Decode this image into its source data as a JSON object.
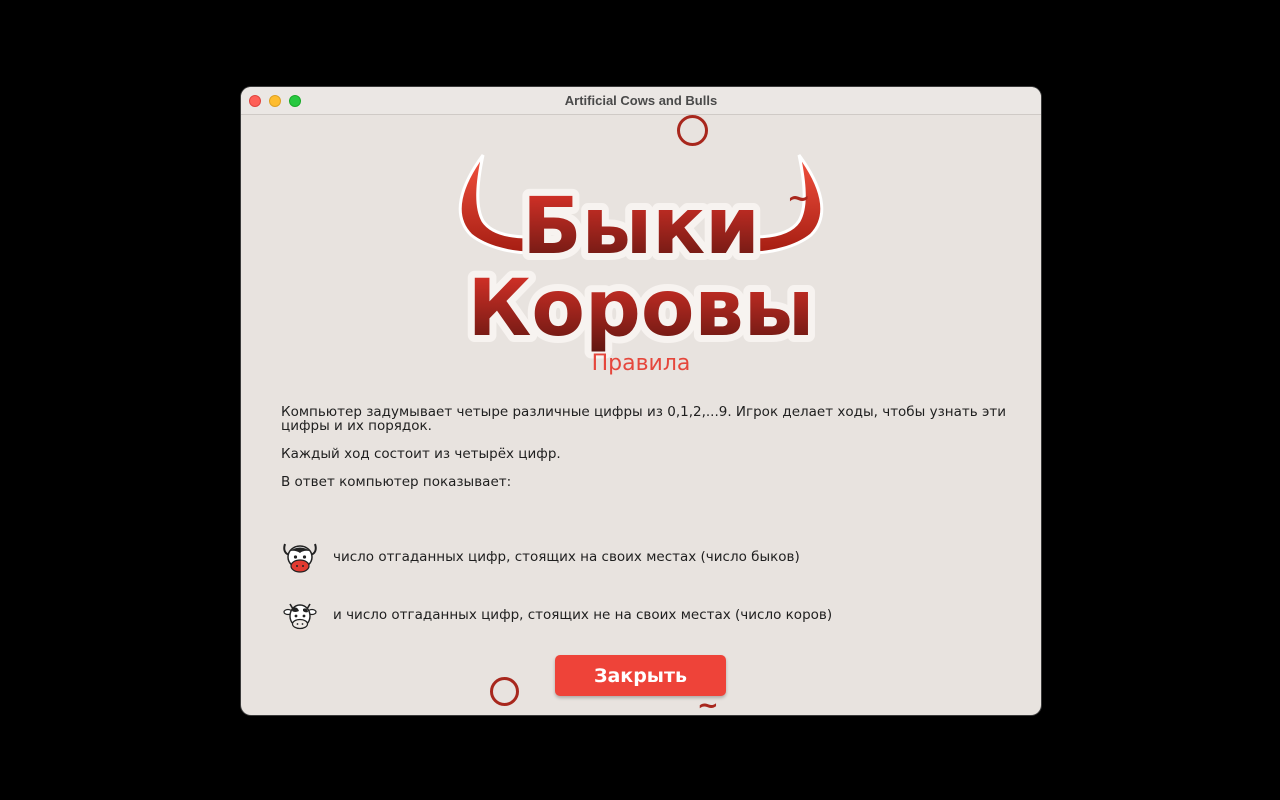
{
  "window": {
    "title": "Artificial Cows and Bulls"
  },
  "logo": {
    "line1": "Быки",
    "line2": "Коровы"
  },
  "heading": "Правила",
  "rules": {
    "p1": "Компьютер задумывает четыре различные цифры из 0,1,2,...9. Игрок делает ходы, чтобы узнать эти цифры и их порядок.",
    "p2": "Каждый ход состоит из четырёх цифр.",
    "p3": "В ответ компьютер показывает:"
  },
  "legend": {
    "bull_text": "число отгаданных цифр, стоящих на своих местах (число быков)",
    "cow_text": "и число отгаданных цифр, стоящих не на своих местах (число коров)"
  },
  "close_button": "Закрыть",
  "colors": {
    "accent": "#ee4339",
    "heading": "#e5473c",
    "deco": "#a8271d",
    "background": "#e8e3df"
  },
  "icons": [
    "bull-icon",
    "cow-icon"
  ]
}
